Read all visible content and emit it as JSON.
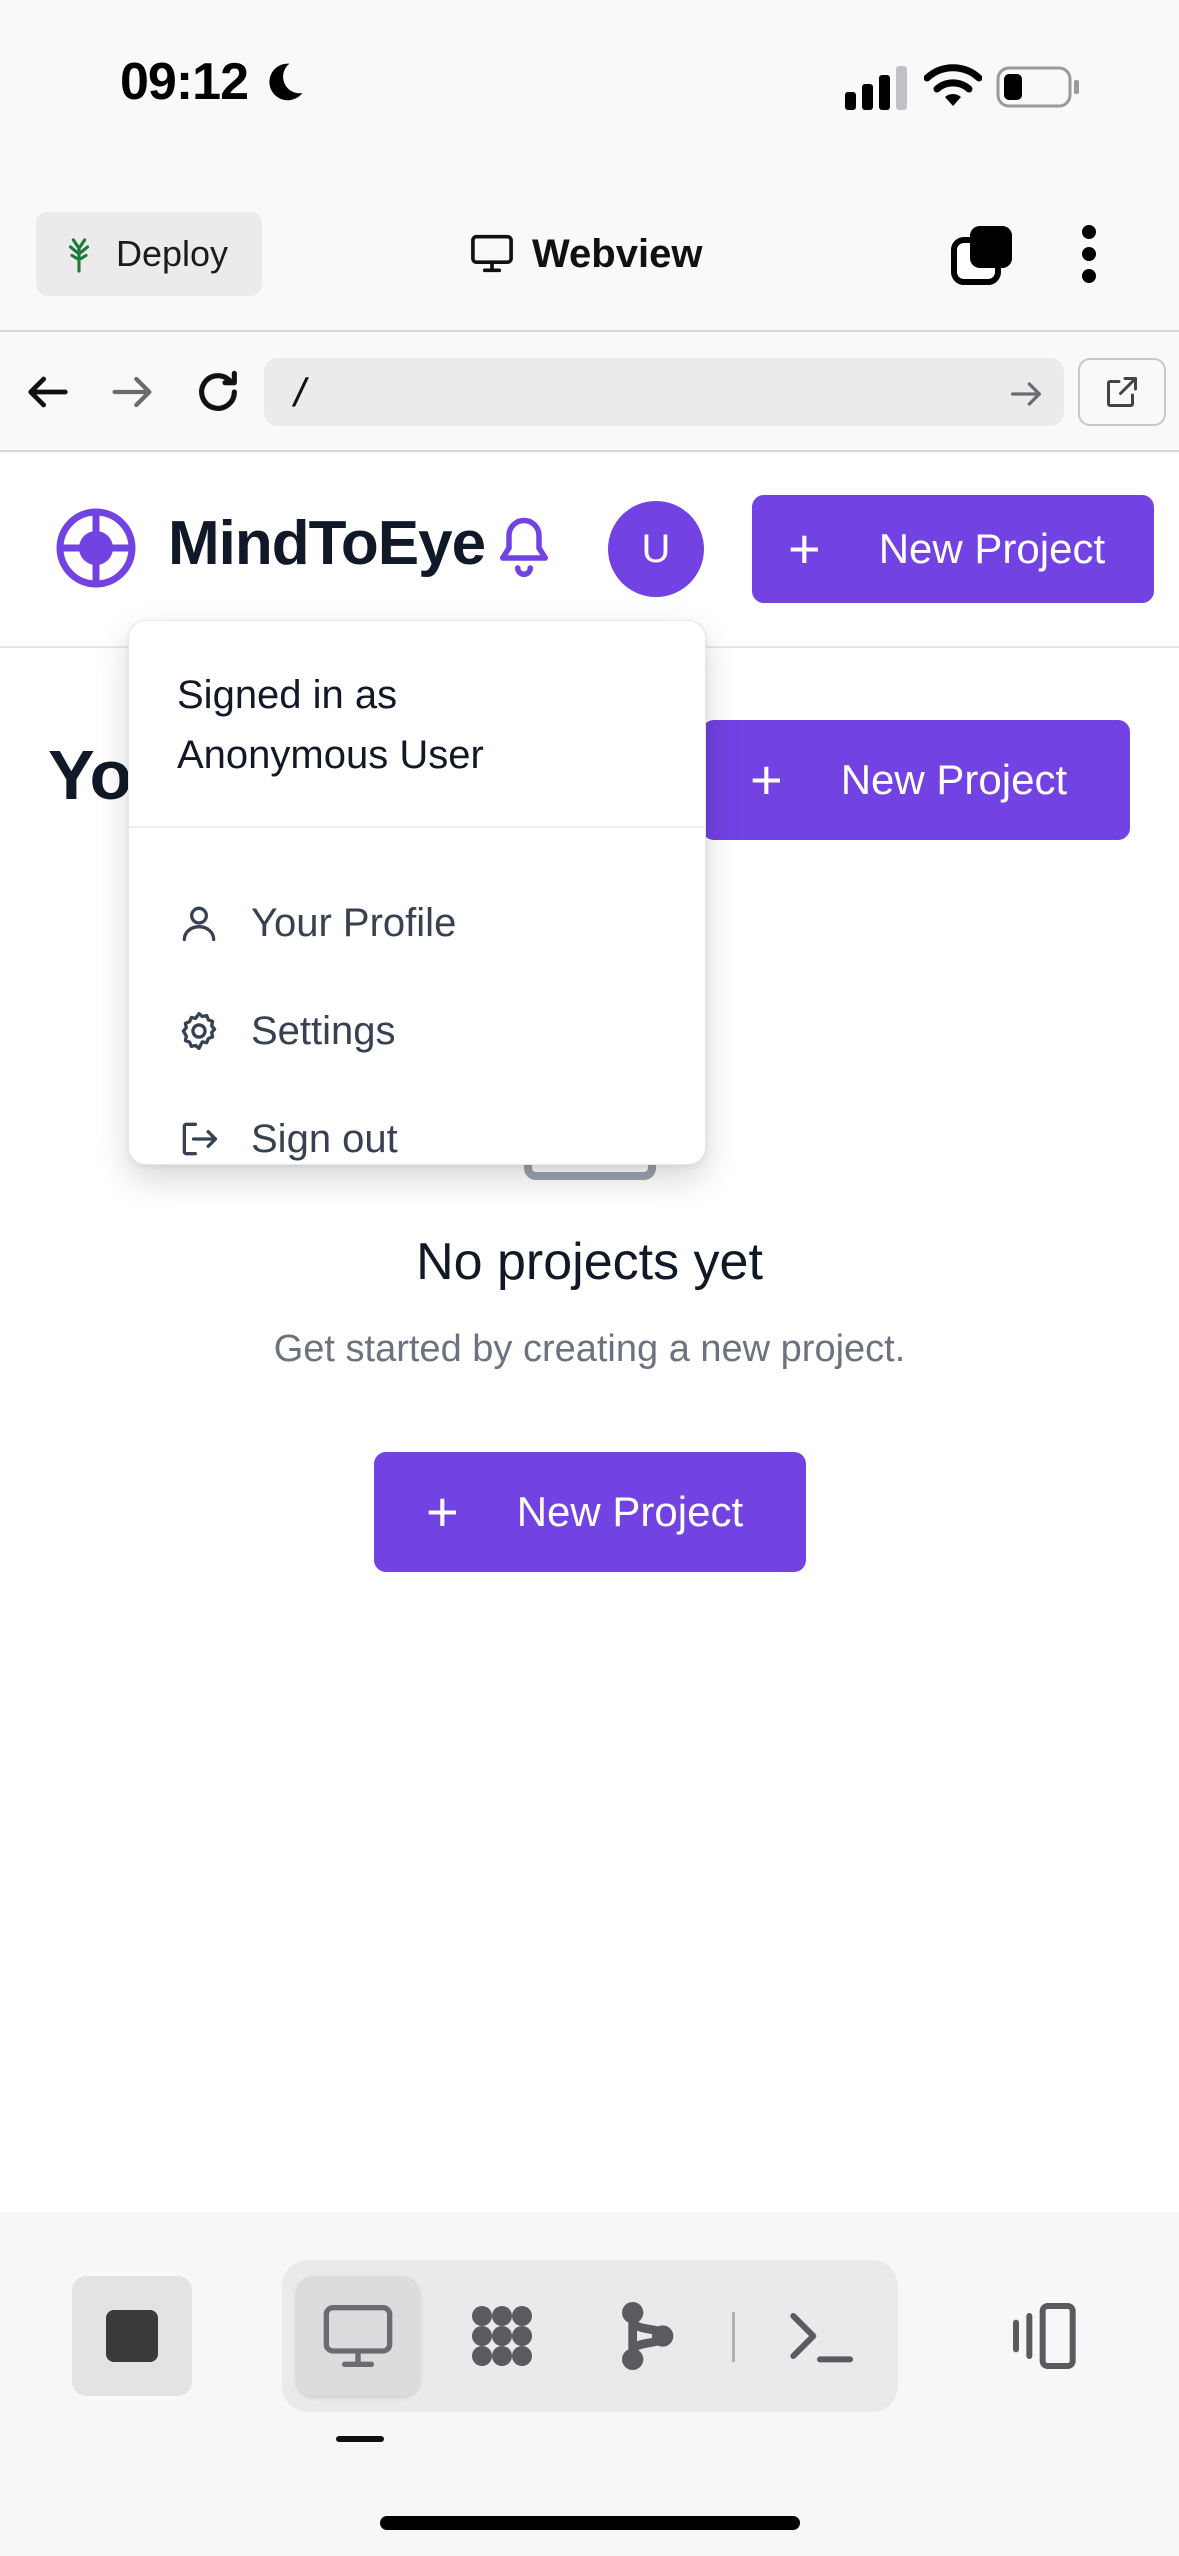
{
  "status_bar": {
    "time": "09:12"
  },
  "replit_header": {
    "deploy_label": "Deploy",
    "title": "Webview"
  },
  "url_bar": {
    "value": "/"
  },
  "app": {
    "brand": "MindToEye",
    "avatar_initial": "U",
    "new_project_label": "New Project",
    "page_title": "Yo",
    "empty_title": "No projects yet",
    "empty_subtitle": "Get started by creating a new project."
  },
  "dropdown": {
    "signed_in_label": "Signed in as",
    "user_name": "Anonymous User",
    "items": [
      {
        "label": "Your Profile",
        "icon": "user-icon"
      },
      {
        "label": "Settings",
        "icon": "gear-icon"
      },
      {
        "label": "Sign out",
        "icon": "sign-out-icon"
      }
    ]
  },
  "colors": {
    "brand": "#7242e2",
    "text": "#111827",
    "muted": "#6b7280"
  }
}
